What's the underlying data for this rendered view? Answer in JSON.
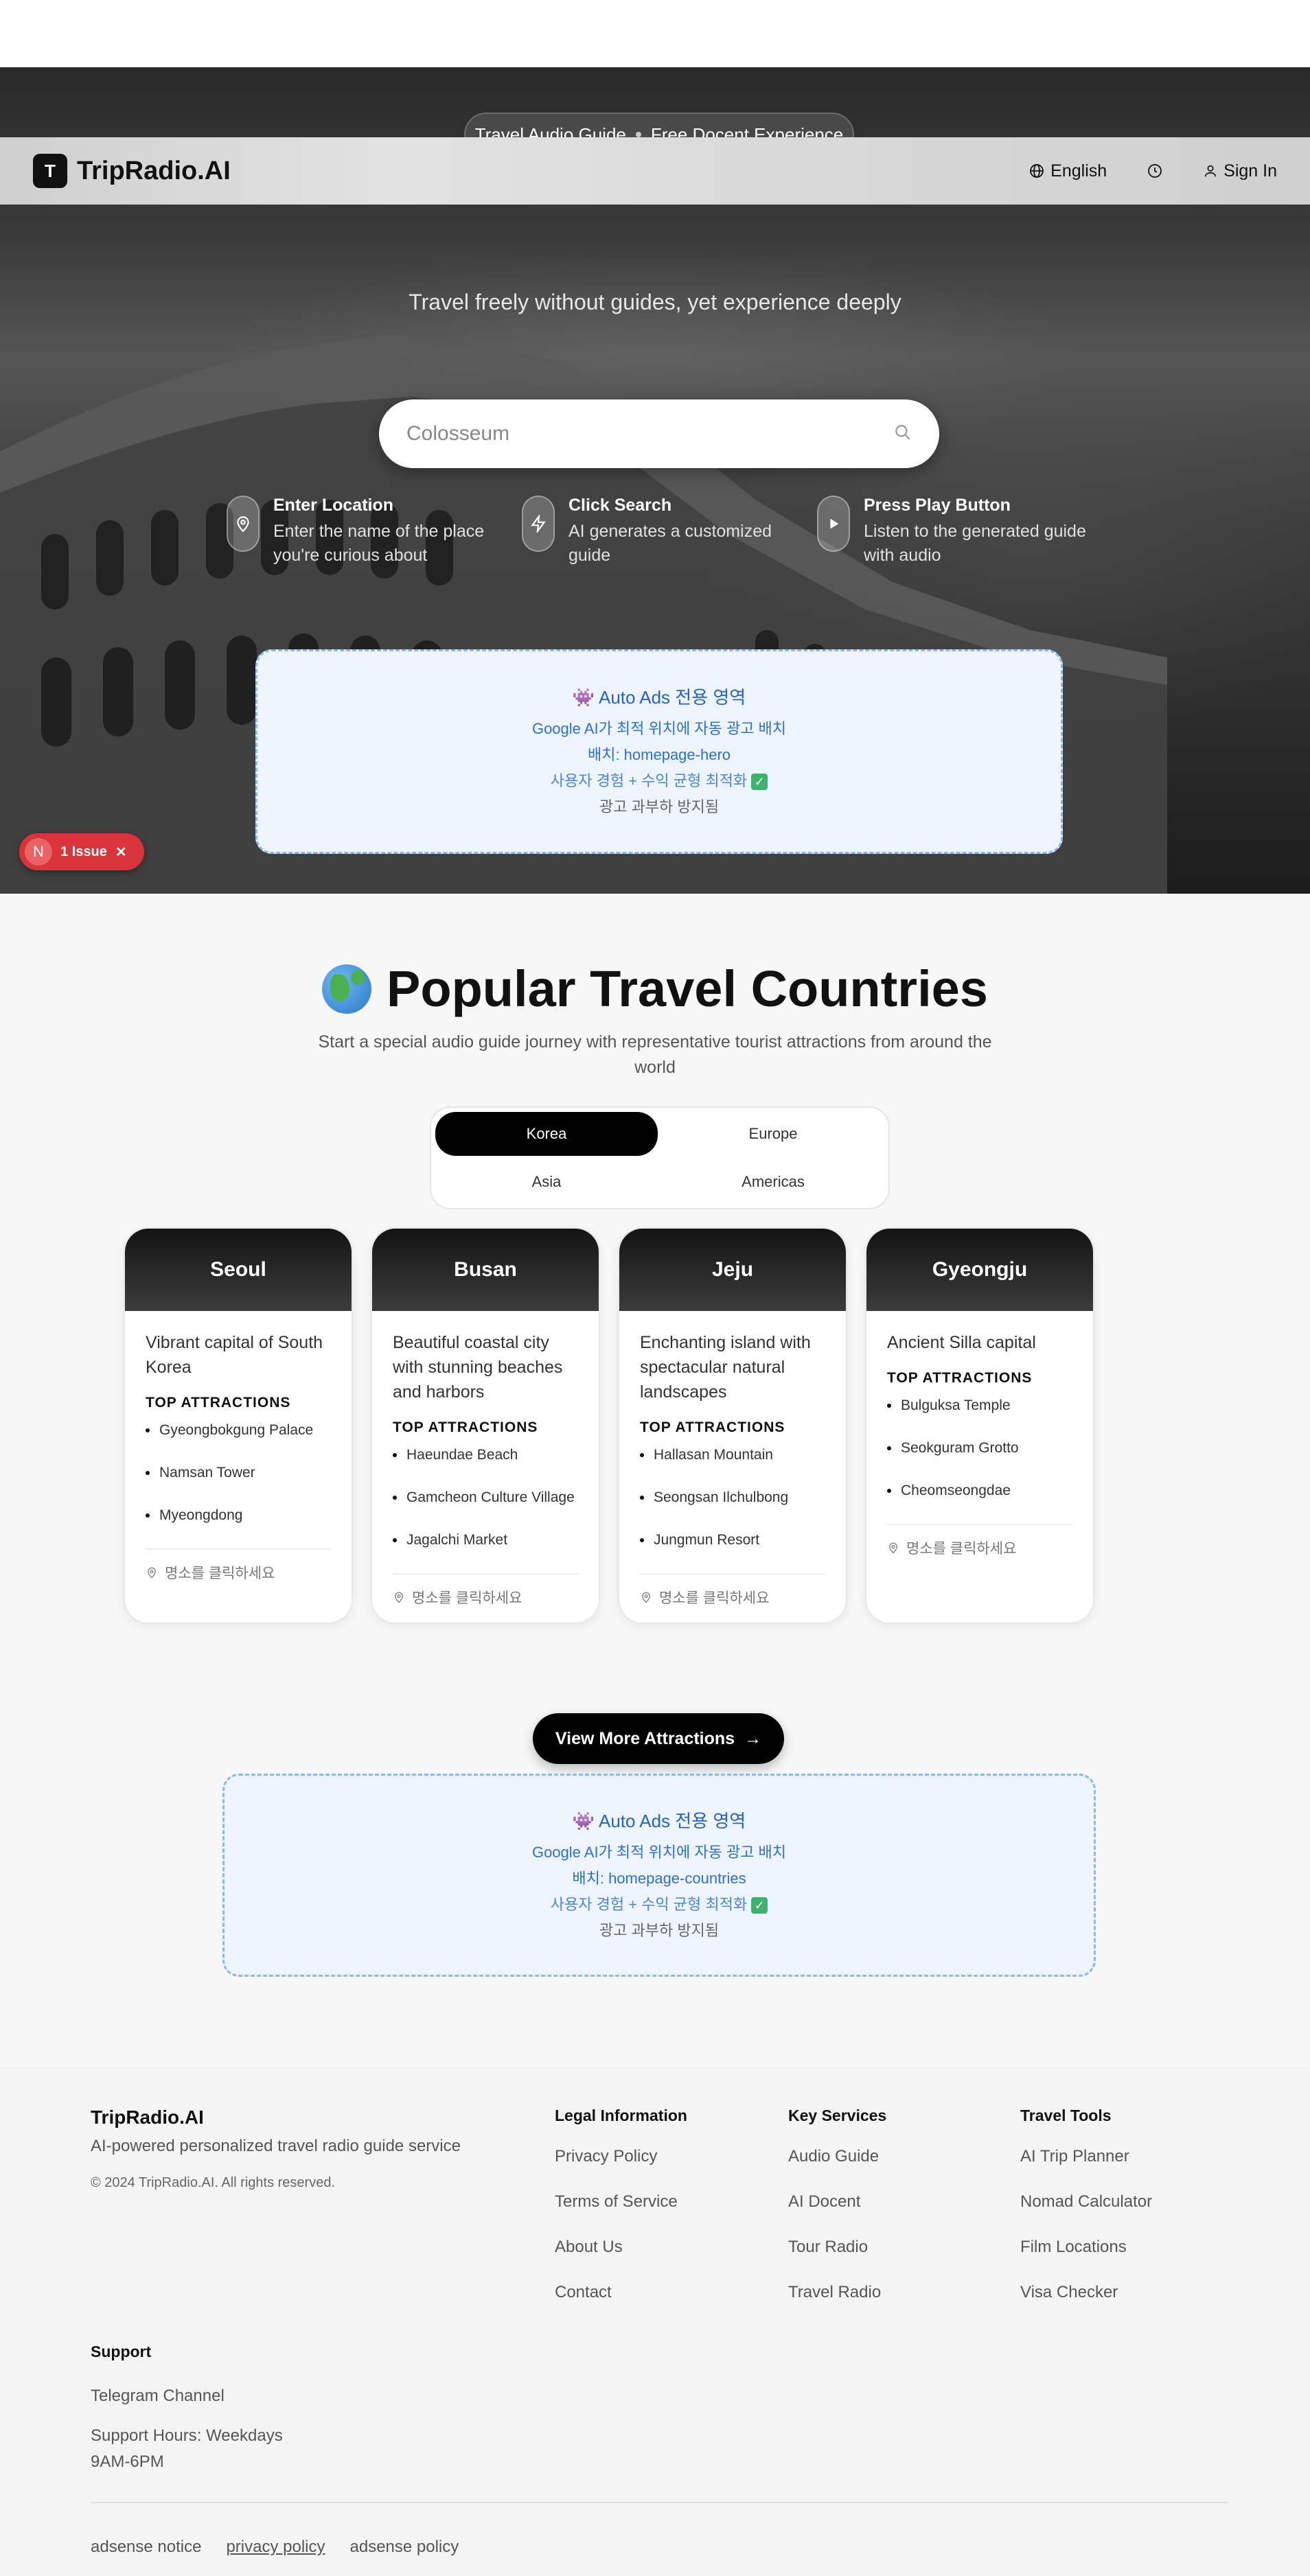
{
  "hero": {
    "pill_left": "Travel Audio Guide",
    "pill_right": "Free Docent Experience",
    "tagline": "Travel freely without guides, yet experience deeply",
    "search_placeholder": "Colosseum"
  },
  "nav": {
    "logo_letter": "T",
    "logo_text": "TripRadio.AI",
    "language": "English",
    "sign_in": "Sign In"
  },
  "steps": [
    {
      "title": "Enter Location",
      "desc": "Enter the name of the place you're curious about",
      "icon": "map-pin-icon"
    },
    {
      "title": "Click Search",
      "desc": "AI generates a customized guide",
      "icon": "lightning-icon"
    },
    {
      "title": "Press Play Button",
      "desc": "Listen to the generated guide with audio",
      "icon": "play-icon"
    }
  ],
  "ad_hero": {
    "title": "👾 Auto Ads 전용 영역",
    "line1": "Google AI가 최적 위치에 자동 광고 배치",
    "line2": "배치: homepage-hero",
    "line3": "사용자 경험 + 수익 균형 최적화",
    "line4": "광고 과부하 방지됨"
  },
  "issue": {
    "badge": "N",
    "label": "1 Issue"
  },
  "popular": {
    "title": "Popular Travel Countries",
    "subtitle": "Start a special audio guide journey with representative tourist attractions from around the world",
    "tabs": [
      "Korea",
      "Europe",
      "Asia",
      "Americas"
    ],
    "attractions_label": "TOP ATTRACTIONS",
    "click_hint": "명소를 클릭하세요",
    "cards": [
      {
        "name": "Seoul",
        "desc": "Vibrant capital of South Korea",
        "attractions": [
          "Gyeongbokgung Palace",
          "Namsan Tower",
          "Myeongdong"
        ]
      },
      {
        "name": "Busan",
        "desc": "Beautiful coastal city with stunning beaches and harbors",
        "attractions": [
          "Haeundae Beach",
          "Gamcheon Culture Village",
          "Jagalchi Market"
        ]
      },
      {
        "name": "Jeju",
        "desc": "Enchanting island with spectacular natural landscapes",
        "attractions": [
          "Hallasan Mountain",
          "Seongsan Ilchulbong",
          "Jungmun Resort"
        ]
      },
      {
        "name": "Gyeongju",
        "desc": "Ancient Silla capital",
        "attractions": [
          "Bulguksa Temple",
          "Seokguram Grotto",
          "Cheomseongdae"
        ]
      }
    ],
    "more_button": "View More Attractions"
  },
  "ad_countries": {
    "title": "👾 Auto Ads 전용 영역",
    "line1": "Google AI가 최적 위치에 자동 광고 배치",
    "line2": "배치: homepage-countries",
    "line3": "사용자 경험 + 수익 균형 최적화",
    "line4": "광고 과부하 방지됨"
  },
  "footer": {
    "brand": "TripRadio.AI",
    "desc": "AI-powered personalized travel radio guide service",
    "copyright": "© 2024 TripRadio.AI. All rights reserved.",
    "legal": {
      "title": "Legal Information",
      "links": [
        "Privacy Policy",
        "Terms of Service",
        "About Us",
        "Contact"
      ]
    },
    "services": {
      "title": "Key Services",
      "links": [
        "Audio Guide",
        "AI Docent",
        "Tour Radio",
        "Travel Radio"
      ]
    },
    "tools": {
      "title": "Travel Tools",
      "links": [
        "AI Trip Planner",
        "Nomad Calculator",
        "Film Locations",
        "Visa Checker"
      ]
    },
    "support": {
      "title": "Support",
      "telegram": "Telegram Channel",
      "hours1": "Support Hours: Weekdays",
      "hours2": "9AM-6PM"
    },
    "bottom": [
      "adsense notice",
      "privacy policy",
      "adsense policy"
    ]
  }
}
